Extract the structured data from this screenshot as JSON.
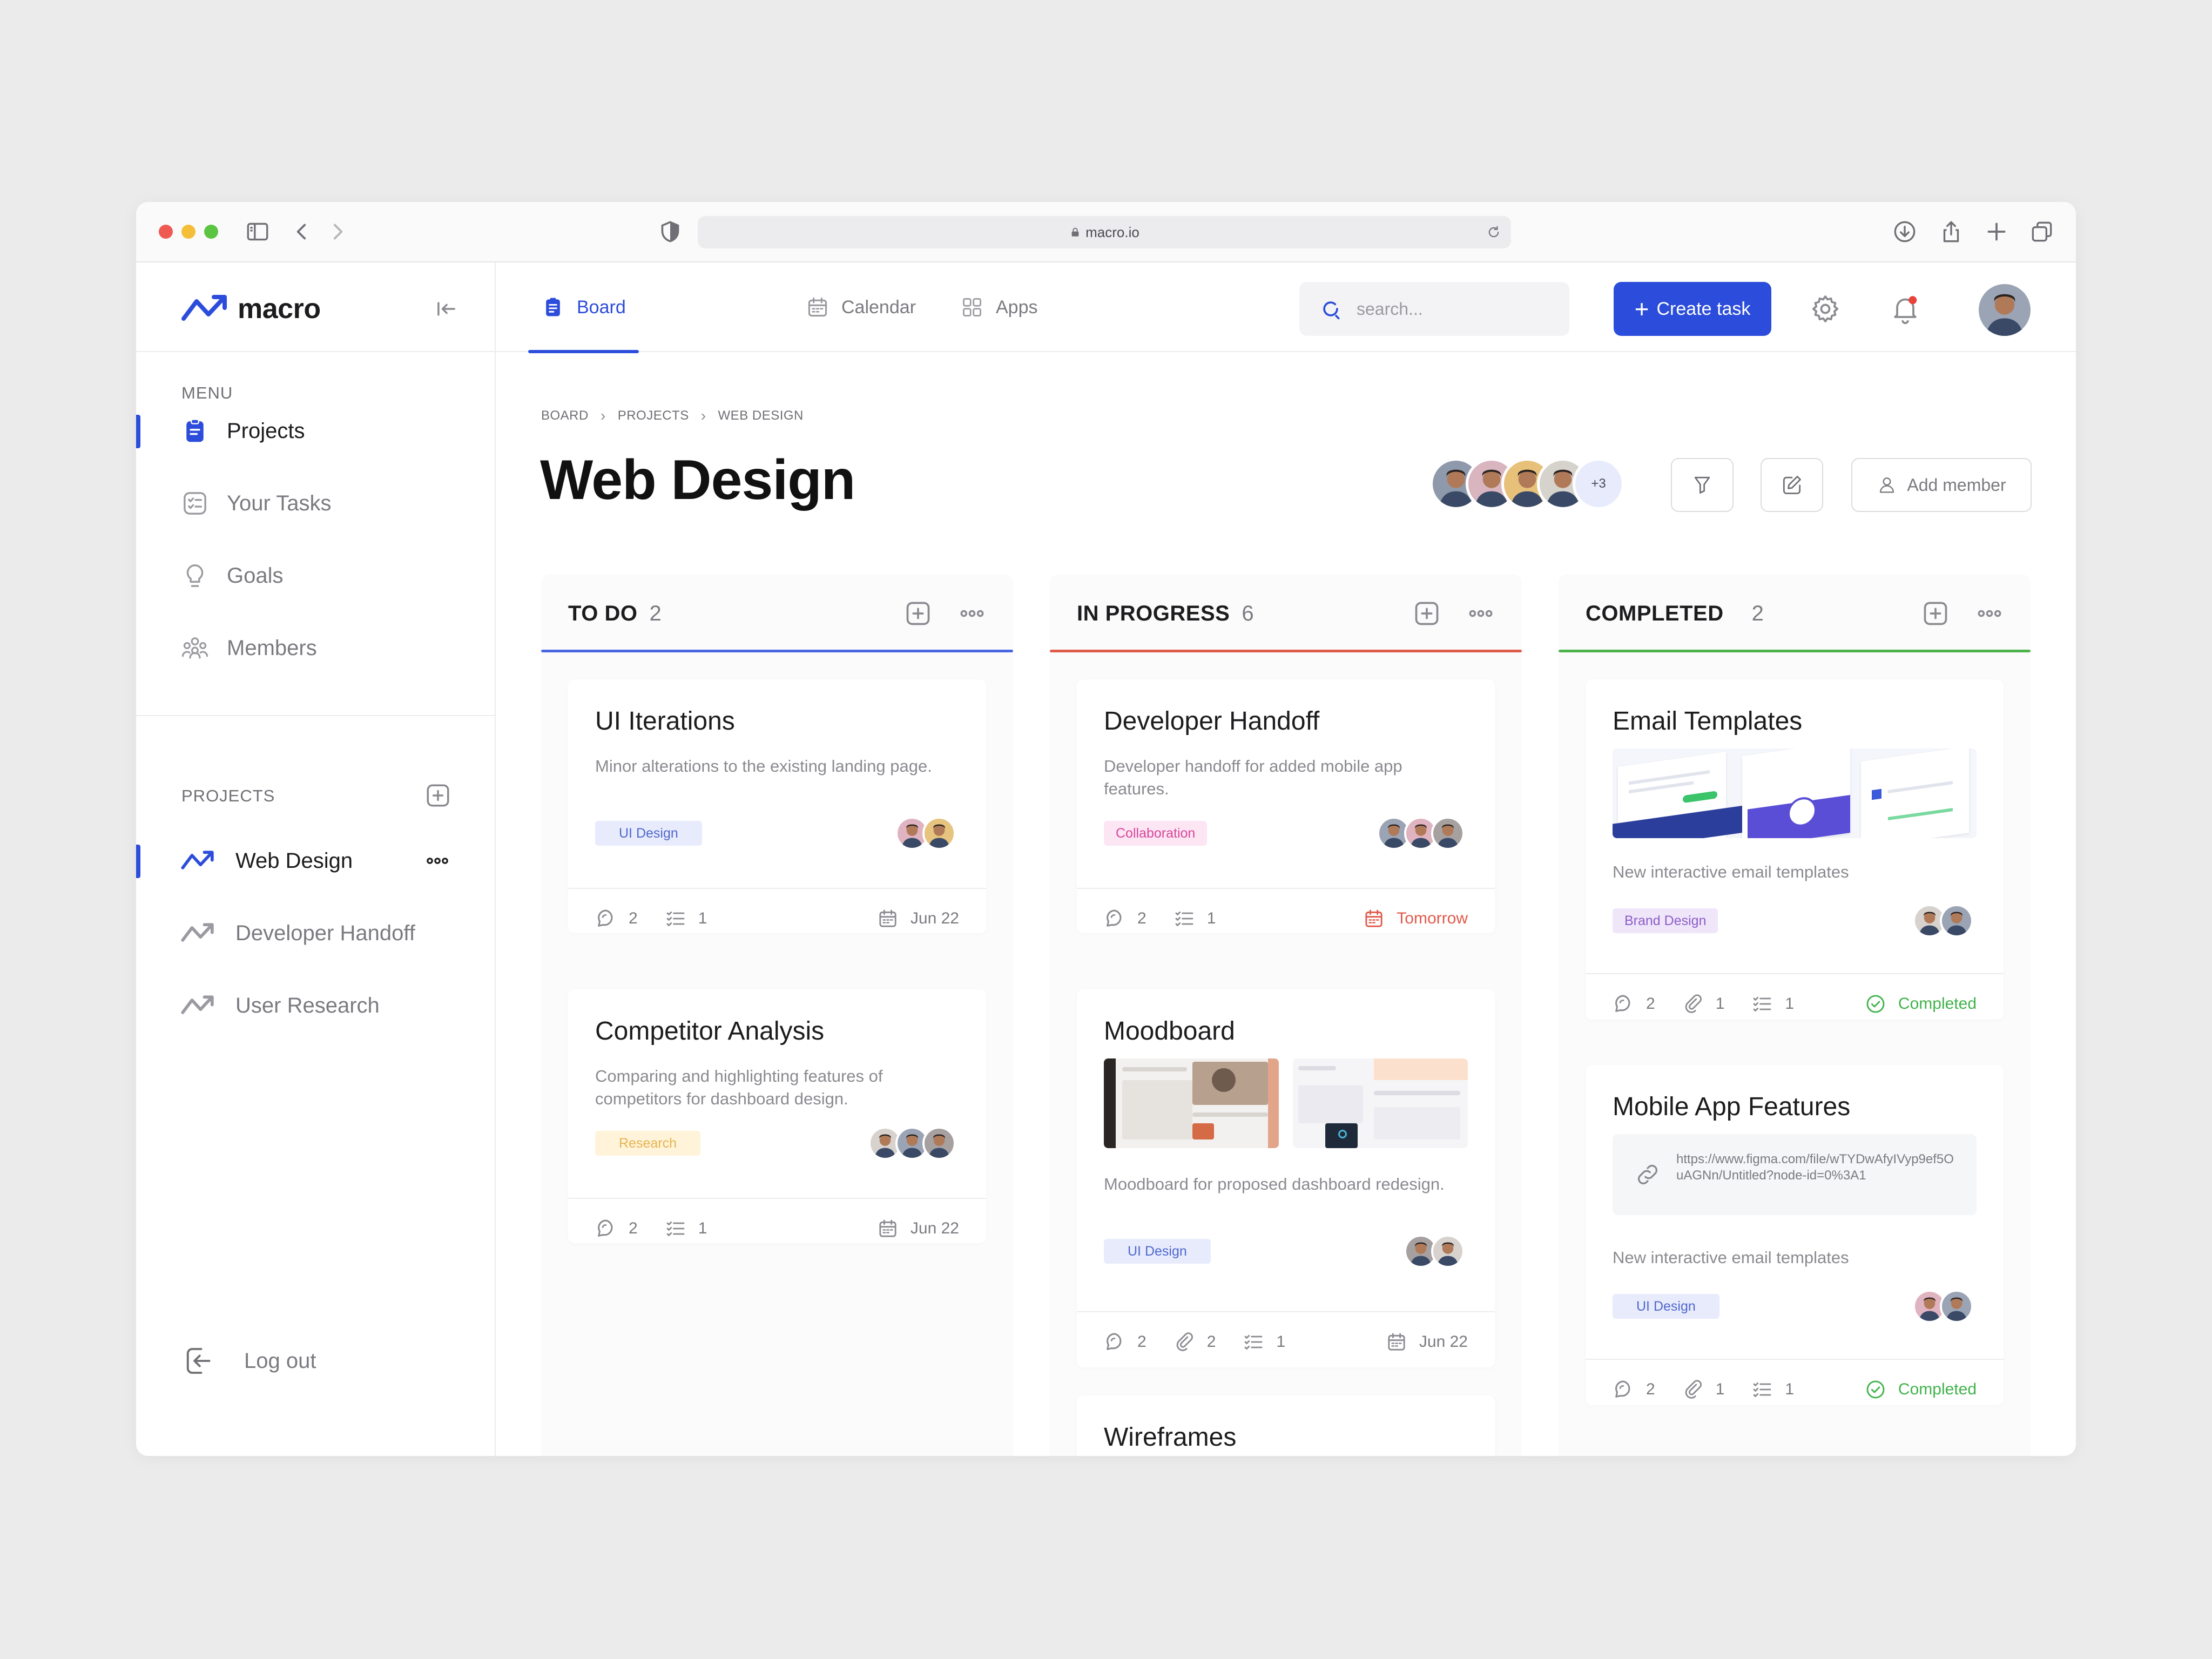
{
  "browser": {
    "url": "macro.io"
  },
  "app": {
    "brand": "macro",
    "menu_heading": "MENU",
    "menu": [
      {
        "label": "Projects",
        "icon": "clipboard-icon",
        "active": true
      },
      {
        "label": "Your Tasks",
        "icon": "tasks-icon",
        "active": false
      },
      {
        "label": "Goals",
        "icon": "bulb-icon",
        "active": false
      },
      {
        "label": "Members",
        "icon": "members-icon",
        "active": false
      }
    ],
    "projects_heading": "PROJECTS",
    "projects": [
      {
        "label": "Web Design",
        "active": true
      },
      {
        "label": "Developer Handoff",
        "active": false
      },
      {
        "label": "User Research",
        "active": false
      }
    ],
    "logout_label": "Log out"
  },
  "topbar": {
    "tabs": [
      {
        "label": "Board",
        "active": true
      },
      {
        "label": "Calendar",
        "active": false
      },
      {
        "label": "Apps",
        "active": false
      }
    ],
    "search_placeholder": "search...",
    "create_label": "Create task"
  },
  "page": {
    "breadcrumb": [
      "BOARD",
      "PROJECTS",
      "WEB DESIGN"
    ],
    "title": "Web Design",
    "members_more": "+3",
    "add_member_label": "Add member"
  },
  "columns": [
    {
      "title": "TO DO",
      "count": "2",
      "accent": "#4766e0",
      "cards": [
        {
          "title": "UI Iterations",
          "desc": "Minor alterations to the existing landing page.",
          "tag": "UI Design",
          "comments": "2",
          "checklist": "1",
          "date": "Jun 22"
        },
        {
          "title": "Competitor Analysis",
          "desc": "Comparing and highlighting features of competitors for dashboard design.",
          "tag": "Research",
          "comments": "2",
          "checklist": "1",
          "date": "Jun 22"
        }
      ]
    },
    {
      "title": "IN PROGRESS",
      "count": "6",
      "accent": "#e05a4a",
      "cards": [
        {
          "title": "Developer Handoff",
          "desc": "Developer handoff for added mobile app features.",
          "tag": "Collaboration",
          "comments": "2",
          "checklist": "1",
          "date": "Tomorrow"
        },
        {
          "title": "Moodboard",
          "desc": "Moodboard for proposed dashboard redesign.",
          "tag": "UI Design",
          "comments": "2",
          "attachments": "2",
          "checklist": "1",
          "date": "Jun 22"
        },
        {
          "title": "Wireframes"
        }
      ]
    },
    {
      "title": "COMPLETED",
      "count": "2",
      "accent": "#4cb34a",
      "cards": [
        {
          "title": "Email Templates",
          "desc": "New interactive email templates",
          "tag": "Brand Design",
          "comments": "2",
          "attachments": "1",
          "checklist": "1",
          "status": "Completed"
        },
        {
          "title": "Mobile App Features",
          "link": "https://www.figma.com/file/wTYDwAfyIVyp9ef5OuAGNn/Untitled?node-id=0%3A1",
          "desc": "New interactive email templates",
          "tag": "UI Design",
          "comments": "2",
          "attachments": "1",
          "checklist": "1",
          "status": "Completed"
        }
      ]
    }
  ],
  "colors": {
    "primary": "#2c4ddb",
    "tag_ui_design_bg": "#e8ebfb",
    "tag_ui_design_fg": "#4f68cf",
    "tag_research_bg": "#fff3d9",
    "tag_research_fg": "#e6b450",
    "tag_collab_bg": "#fde6f3",
    "tag_collab_fg": "#d6479c",
    "tag_brand_bg": "#efe6fa",
    "tag_brand_fg": "#8e5dc8",
    "due_soon": "#e05a4a",
    "completed": "#3fb349"
  }
}
